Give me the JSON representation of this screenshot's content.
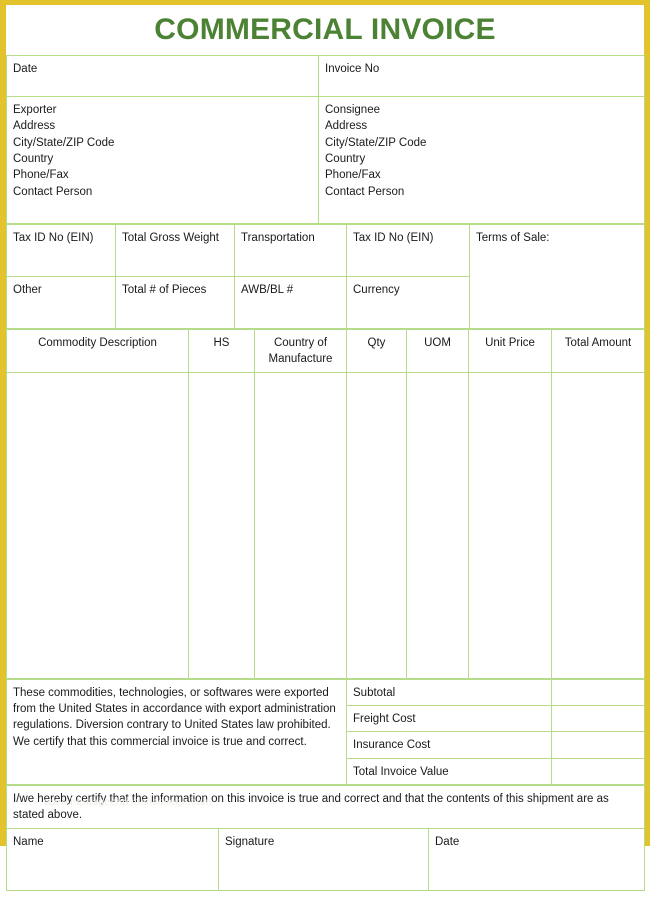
{
  "document": {
    "title": "COMMERCIAL INVOICE",
    "watermark": "www.heritagechristiancollege.com"
  },
  "header_row": {
    "date_label": "Date",
    "invoice_no_label": "Invoice No"
  },
  "parties": {
    "exporter": {
      "line1": "Exporter",
      "line2": "Address",
      "line3": "City/State/ZIP Code",
      "line4": "Country",
      "line5": "Phone/Fax",
      "line6": "Contact Person"
    },
    "consignee": {
      "line1": "Consignee",
      "line2": "Address",
      "line3": "City/State/ZIP Code",
      "line4": "Country",
      "line5": "Phone/Fax",
      "line6": "Contact Person"
    }
  },
  "shipment": {
    "row1": {
      "tax_id_exporter": "Tax ID No (EIN)",
      "total_gross_weight": "Total Gross Weight",
      "transportation": "Transportation",
      "tax_id_consignee": "Tax ID No (EIN)"
    },
    "row2": {
      "other": "Other",
      "total_pieces": "Total # of Pieces",
      "awb_bl": "AWB/BL #",
      "currency": "Currency"
    },
    "terms_of_sale": "Terms of Sale:"
  },
  "commodity_table": {
    "columns": [
      "Commodity Description",
      "HS",
      "Country of Manufacture",
      "Qty",
      "UOM",
      "Unit Price",
      "Total Amount"
    ],
    "rows": []
  },
  "footer": {
    "export_statement": "These commodities, technologies, or softwares were exported from the United States in accordance with export administration regulations. Diversion contrary to United States law prohibited. We certify that this commercial invoice is true and correct.",
    "totals": [
      {
        "label": "Subtotal",
        "value": ""
      },
      {
        "label": "Freight Cost",
        "value": ""
      },
      {
        "label": "Insurance Cost",
        "value": ""
      },
      {
        "label": "Total Invoice Value",
        "value": ""
      }
    ],
    "certification": "I/we hereby certify that the information on this invoice is true and correct and that the contents of this shipment are as stated above.",
    "signature_block": {
      "name_label": "Name",
      "signature_label": "Signature",
      "date_label": "Date"
    }
  },
  "colors": {
    "frame": "#e2c32c",
    "cell_border": "#b6dc8a",
    "fill_green": "#e6f1d8",
    "title_green": "#4c8234"
  }
}
